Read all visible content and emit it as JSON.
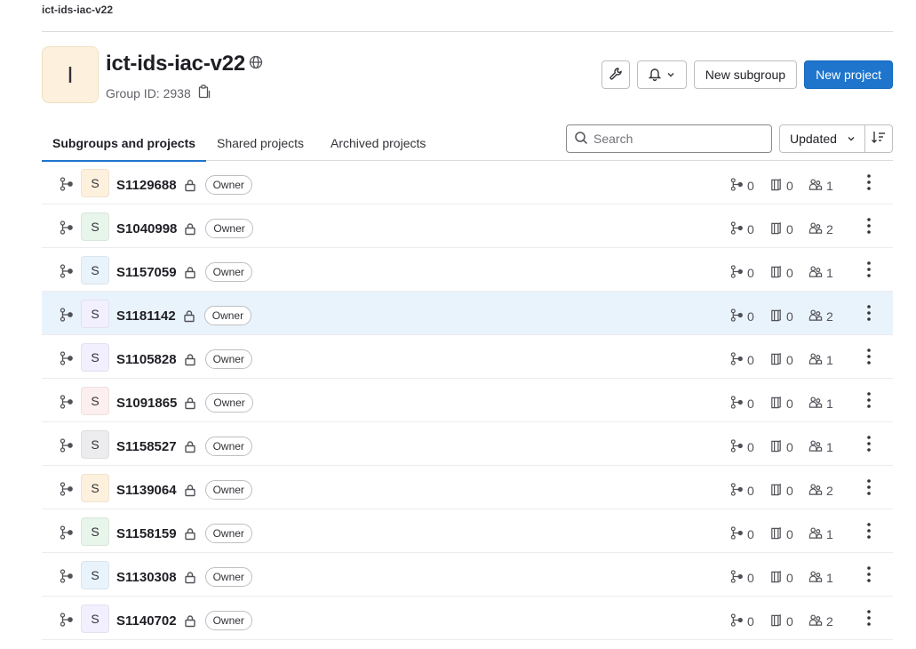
{
  "breadcrumb": "ict-ids-iac-v22",
  "group": {
    "avatar_letter": "I",
    "name": "ict-ids-iac-v22",
    "group_id": "Group ID: 2938"
  },
  "actions": {
    "new_subgroup": "New subgroup",
    "new_project": "New project"
  },
  "tabs": [
    "Subgroups and projects",
    "Shared projects",
    "Archived projects"
  ],
  "search": {
    "placeholder": "Search"
  },
  "sort": {
    "label": "Updated"
  },
  "colors": {
    "primary": "#1f75cb",
    "highlight_row": "#e9f3fc"
  },
  "rows": [
    {
      "letter": "S",
      "name": "S1129688",
      "role": "Owner",
      "subgroups": "0",
      "projects": "0",
      "members": "1",
      "avatar_bg": "#fdf1dd"
    },
    {
      "letter": "S",
      "name": "S1040998",
      "role": "Owner",
      "subgroups": "0",
      "projects": "0",
      "members": "2",
      "avatar_bg": "#e7f5ea"
    },
    {
      "letter": "S",
      "name": "S1157059",
      "role": "Owner",
      "subgroups": "0",
      "projects": "0",
      "members": "1",
      "avatar_bg": "#e9f3fc"
    },
    {
      "letter": "S",
      "name": "S1181142",
      "role": "Owner",
      "subgroups": "0",
      "projects": "0",
      "members": "2",
      "avatar_bg": "#f2efff"
    },
    {
      "letter": "S",
      "name": "S1105828",
      "role": "Owner",
      "subgroups": "0",
      "projects": "0",
      "members": "1",
      "avatar_bg": "#f2efff"
    },
    {
      "letter": "S",
      "name": "S1091865",
      "role": "Owner",
      "subgroups": "0",
      "projects": "0",
      "members": "1",
      "avatar_bg": "#fdefef"
    },
    {
      "letter": "S",
      "name": "S1158527",
      "role": "Owner",
      "subgroups": "0",
      "projects": "0",
      "members": "1",
      "avatar_bg": "#ececef"
    },
    {
      "letter": "S",
      "name": "S1139064",
      "role": "Owner",
      "subgroups": "0",
      "projects": "0",
      "members": "2",
      "avatar_bg": "#fdf1dd"
    },
    {
      "letter": "S",
      "name": "S1158159",
      "role": "Owner",
      "subgroups": "0",
      "projects": "0",
      "members": "1",
      "avatar_bg": "#e7f5ea"
    },
    {
      "letter": "S",
      "name": "S1130308",
      "role": "Owner",
      "subgroups": "0",
      "projects": "0",
      "members": "1",
      "avatar_bg": "#e9f3fc"
    },
    {
      "letter": "S",
      "name": "S1140702",
      "role": "Owner",
      "subgroups": "0",
      "projects": "0",
      "members": "2",
      "avatar_bg": "#f2efff"
    }
  ]
}
